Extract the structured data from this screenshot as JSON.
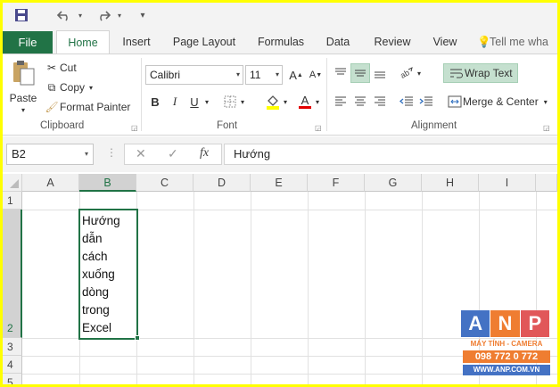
{
  "qat": {
    "customize_label": "▾"
  },
  "tabs": [
    {
      "label": "File"
    },
    {
      "label": "Home"
    },
    {
      "label": "Insert"
    },
    {
      "label": "Page Layout"
    },
    {
      "label": "Formulas"
    },
    {
      "label": "Data"
    },
    {
      "label": "Review"
    },
    {
      "label": "View"
    }
  ],
  "tell_me": "Tell me wha",
  "clipboard": {
    "paste": "Paste",
    "cut": "Cut",
    "copy": "Copy",
    "format_painter": "Format Painter",
    "group": "Clipboard"
  },
  "font": {
    "family": "Calibri",
    "size": "11",
    "bold": "B",
    "italic": "I",
    "underline": "U",
    "group": "Font",
    "grow": "A",
    "shrink": "A",
    "color_a": "A"
  },
  "alignment": {
    "wrap_text": "Wrap Text",
    "merge_center": "Merge & Center",
    "group": "Alignment"
  },
  "formula_bar": {
    "name_box": "B2",
    "cancel": "✕",
    "enter": "✓",
    "fx": "fx",
    "content": "Hướng"
  },
  "grid": {
    "columns": [
      "A",
      "B",
      "C",
      "D",
      "E",
      "F",
      "G",
      "H",
      "I"
    ],
    "rows": [
      "1",
      "2",
      "3",
      "4",
      "5"
    ],
    "cell_b2": "Hướng\ndẫn\ncách\nxuống\ndòng\ntrong\nExcel"
  },
  "watermark": {
    "letters": [
      "A",
      "N",
      "P"
    ],
    "line1": "MÁY TÍNH - CAMERA",
    "line2": "098 772 0 772",
    "line3": "WWW.ANP.COM.VN",
    "colors": {
      "a": "#4472c4",
      "n": "#ef7d31",
      "p": "#e15759"
    }
  }
}
